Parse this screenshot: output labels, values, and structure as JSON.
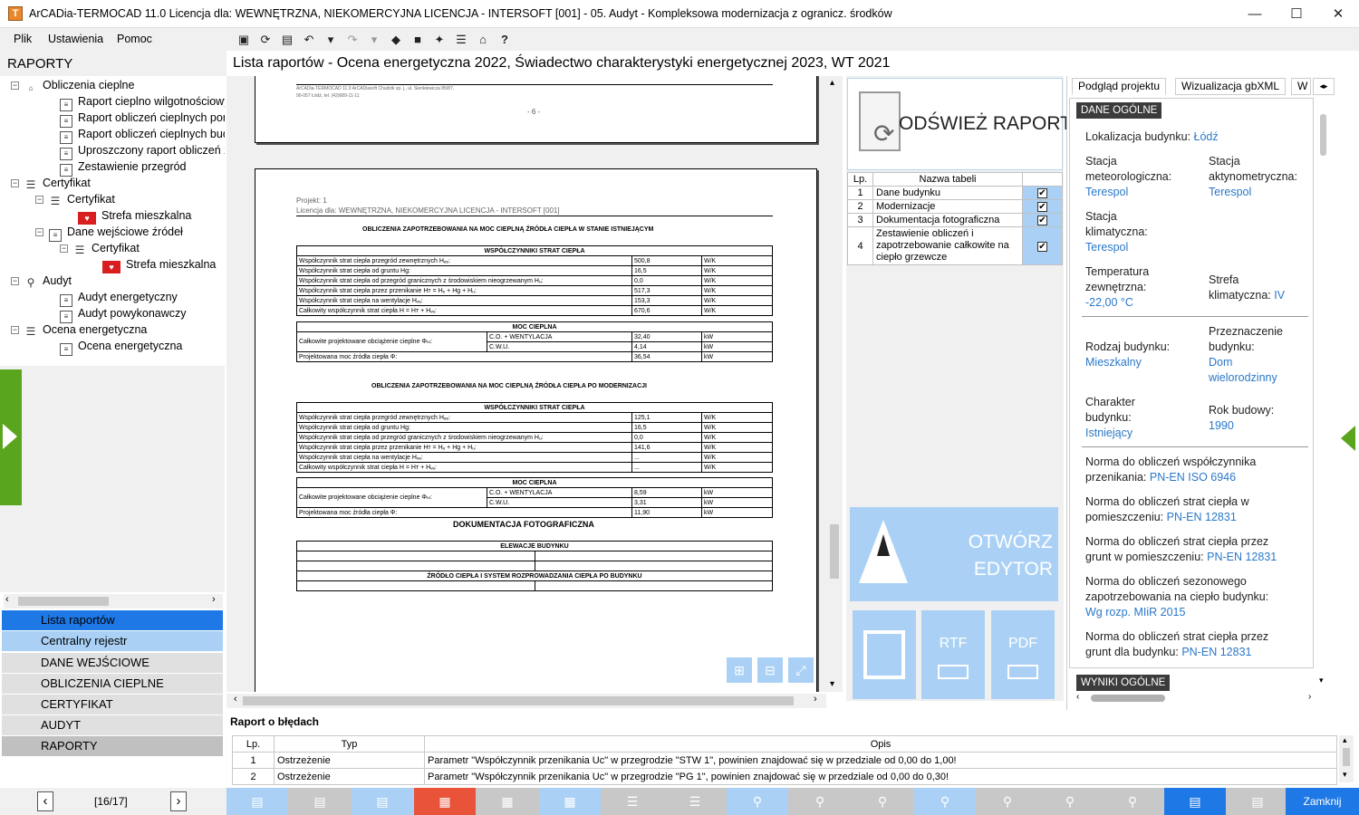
{
  "window": {
    "title": "ArCADia-TERMOCAD 11.0 Licencja dla: WEWNĘTRZNA, NIEKOMERCYJNA LICENCJA - INTERSOFT [001] - 05. Audyt - Kompleksowa modernizacja z ogranicz. środków",
    "minimize": "—",
    "maximize": "☐",
    "close": "✕",
    "app_icon_letter": "T"
  },
  "menu": {
    "file": "Plik",
    "settings": "Ustawienia",
    "help": "Pomoc"
  },
  "toolbar": {
    "icons": [
      "save-icon",
      "refresh-icon",
      "preview-icon",
      "undo-icon",
      "dropdown-icon",
      "redo-icon",
      "dropdown-icon",
      "stamp-icon",
      "lock-icon",
      "wrench-icon",
      "list-icon",
      "export-icon",
      "help-icon"
    ],
    "help_label": "?"
  },
  "left": {
    "header": "RAPORTY"
  },
  "tree": {
    "n0": "Obliczenia cieplne",
    "n1": "Raport cieplno wilgotnościowy",
    "n2": "Raport obliczeń cieplnych pom",
    "n3": "Raport obliczeń cieplnych bud",
    "n4": "Uproszczony raport obliczeń za",
    "n5": "Zestawienie przegród",
    "n6": "Certyfikat",
    "n7": "Certyfikat",
    "n8": "Strefa mieszkalna",
    "n9": "Dane wejściowe źródeł",
    "n10": "Certyfikat",
    "n11": "Strefa mieszkalna",
    "n12": "Audyt",
    "n13": "Audyt energetyczny",
    "n14": "Audyt powykonawczy",
    "n15": "Ocena energetyczna",
    "n16": "Ocena energetyczna"
  },
  "nav": {
    "b0": "Lista raportów",
    "b1": "Centralny rejestr",
    "b2": "DANE WEJŚCIOWE",
    "b3": "OBLICZENIA CIEPLNE",
    "b4": "CERTYFIKAT",
    "b5": "AUDYT",
    "b6": "RAPORTY"
  },
  "pager": {
    "text": "[16/17]",
    "prev": "‹",
    "next": "›"
  },
  "main": {
    "header": "Lista raportów - Ocena energetyczna 2022, Świadectwo charakterystyki energetycznej 2023, WT 2021"
  },
  "doc": {
    "p1_line1": "ArCADia-TERMOCAD 11.0 ArCADiasoft Chudzik sp. j., ul. Sienkiewicza 85/87,",
    "p1_line2": "90-057 Łódź, tel. (42)689-11-11",
    "page_no": "- 6 -",
    "projekt": "Projekt: 1",
    "licencja": "Licencja dla: WEWNĘTRZNA, NIEKOMERCYJNA LICENCJA - INTERSOFT [001]",
    "title1": "OBLICZENIA ZAPOTRZEBOWANIA NA MOC CIEPLNĄ ŹRÓDŁA CIEPŁA W STANIE ISTNIEJĄCYM",
    "title2": "OBLICZENIA ZAPOTRZEBOWANIA NA MOC CIEPLNĄ ŹRÓDŁA CIEPŁA PO MODERNIZACJI",
    "wsp_head": "WSPÓŁCZYNNIKI STRAT CIEPŁA",
    "moc_head": "MOC CIEPLNA",
    "r1": "Współczynnik strat ciepła przegród zewnętrznych Hₑₑ:",
    "r2": "Współczynnik strat ciepła od gruntu Hg:",
    "r3": "Współczynnik strat ciepła od przegród granicznych z środowiskiem nieogrzewanym Hᵤ:",
    "r4": "Współczynnik strat ciepła przez przenikanie Hт = Hₑ + Hg + Hᵤ:",
    "r5": "Współczynnik strat ciepła na wentylacje Hᵥₑ:",
    "r6": "Całkowity współczynnik strat ciepła H = Hт + Hᵥₑ:",
    "unit_wk": "W/K",
    "unit_kw": "kW",
    "a1": "500,8",
    "a2": "16,5",
    "a3": "0,0",
    "a4": "517,3",
    "a5": "153,3",
    "a6": "670,6",
    "b1": "125,1",
    "b2": "16,5",
    "b3": "0,0",
    "b4": "141,6",
    "b5": "...",
    "b6": "...",
    "load": "Całkowite projektowane obciążenie cieplne Φₕₗ:",
    "co": "C.O. + WENTYLACJA",
    "cwu": "C.W.U.",
    "proj": "Projektowana moc źródła ciepła Φ:",
    "a_co": "32,40",
    "a_cwu": "4,14",
    "a_proj": "36,54",
    "b_co": "8,59",
    "b_cwu": "3,31",
    "b_proj": "11,90",
    "doc_foto": "DOKUMENTACJA FOTOGRAFICZNA",
    "elew": "ELEWACJE BUDYNKU",
    "zrodlo": "ŹRÓDŁO CIEPŁA I SYSTEM ROZPROWADZANIA CIEPŁA PO BUDYNKU"
  },
  "mid": {
    "refresh_label": "ODŚWIEŻ RAPORT",
    "col_lp": "Lp.",
    "col_name": "Nazwa tabeli",
    "rows": [
      {
        "lp": "1",
        "name": "Dane budynku"
      },
      {
        "lp": "2",
        "name": "Modernizacje"
      },
      {
        "lp": "3",
        "name": "Dokumentacja fotograficzna"
      },
      {
        "lp": "4",
        "name": "Zestawienie obliczeń i zapotrzebowanie całkowite na ciepło grzewcze"
      }
    ],
    "check": "✔",
    "editor_1": "OTWÓRZ",
    "editor_2": "EDYTOR",
    "rtf": "RTF",
    "pdf": "PDF"
  },
  "right": {
    "tab1": "Podgląd projektu",
    "tab2": "Wizualizacja gbXML",
    "tab3": "W",
    "sec1": "DANE OGÓLNE",
    "sec2": "WYNIKI OGÓLNE",
    "loc_l": "Lokalizacja budynku:",
    "loc_v": "Łódź",
    "met_l1": "Stacja",
    "met_l2": "meteorologiczna:",
    "met_v": "Terespol",
    "akt_l1": "Stacja",
    "akt_l2": "aktynometryczna:",
    "akt_v": "Terespol",
    "kli_l1": "Stacja",
    "kli_l2": "klimatyczna:",
    "kli_v": "Terespol",
    "temp_l1": "Temperatura",
    "temp_l2": "zewnętrzna:",
    "temp_v": "-22,00 °C",
    "str_l1": "Strefa",
    "str_l2": "klimatyczna:",
    "str_v": "IV",
    "rodz_l": "Rodzaj budynku:",
    "rodz_v": "Mieszkalny",
    "prz_l1": "Przeznaczenie",
    "prz_l2": "budynku:",
    "prz_v1": "Dom",
    "prz_v2": "wielorodzinny",
    "char_l1": "Charakter",
    "char_l2": "budynku:",
    "char_v": "Istniejący",
    "rok_l": "Rok budowy:",
    "rok_v": "1990",
    "n1_l1": "Norma do obliczeń współczynnika",
    "n1_l2": "przenikania:",
    "n1_v": "PN-EN ISO 6946",
    "n2_l1": "Norma do obliczeń strat ciepła w",
    "n2_l2": "pomieszczeniu:",
    "n2_v": "PN-EN 12831",
    "n3_l1": "Norma do obliczeń strat ciepła przez",
    "n3_l2": "grunt w pomieszczeniu:",
    "n3_v": "PN-EN 12831",
    "n4_l1": "Norma do obliczeń sezonowego",
    "n4_l2": "zapotrzebowania na ciepło budynku:",
    "n4_v": "Wg rozp. MIiR 2015",
    "n5_l1": "Norma do obliczeń strat ciepła przez",
    "n5_l2": "grunt dla budynku:",
    "n5_v": "PN-EN 12831"
  },
  "errors": {
    "title": "Raport o błędach",
    "col_lp": "Lp.",
    "col_type": "Typ",
    "col_desc": "Opis",
    "rows": [
      {
        "lp": "1",
        "type": "Ostrzeżenie",
        "desc": "Parametr \"Współczynnik przenikania Uc\" w przegrodzie \"STW 1\", powinien znajdować się w przedziale od 0,00 do 1,00!"
      },
      {
        "lp": "2",
        "type": "Ostrzeżenie",
        "desc": "Parametr \"Współczynnik przenikania Uc\" w przegrodzie \"PG 1\", powinien znajdować się w przedziale od 0,00 do 0,30!"
      }
    ]
  },
  "bottom": {
    "close": "Zamknij"
  },
  "colors": {
    "accent_blue": "#1e78e6",
    "light_blue": "#aad1f5",
    "green": "#5aa51e",
    "red_btn": "#e8533a",
    "link": "#2a78c8"
  }
}
